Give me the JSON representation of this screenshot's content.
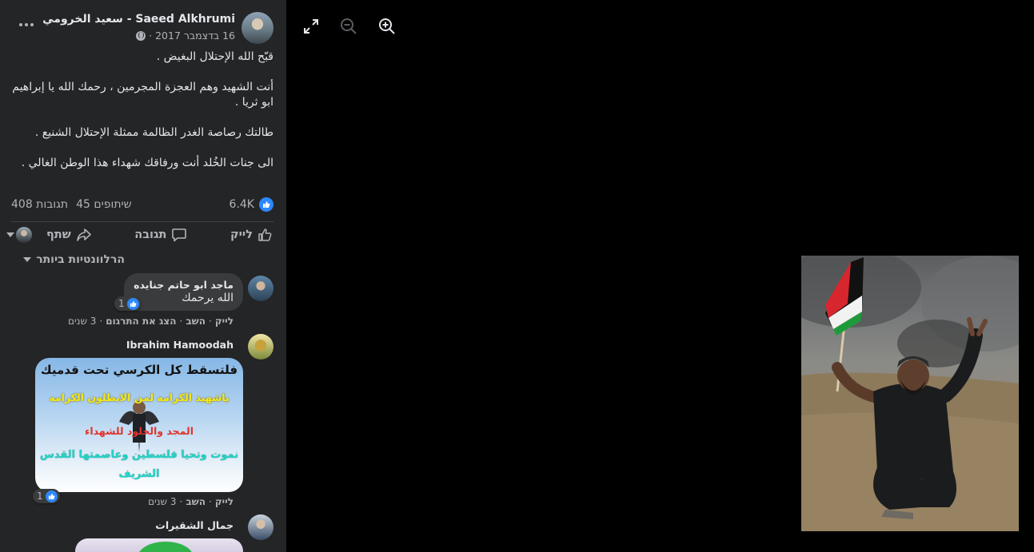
{
  "post": {
    "author": "Saeed Alkhrumi - سعيد الخرومي",
    "date": "16 בדצמבר 2017 ·",
    "text": [
      "قبّح الله الإحتلال البغيض .",
      "أنت الشهيد وهم العجزة المجرمين ، رحمك الله يا إبراهيم ابو ثريا .",
      "طالتك رصاصة الغدر الظالمة ممثلة الإحتلال الشنيع .",
      "الى جنات الخُلد أنت ورفاقك شهداء هذا الوطن الغالي ."
    ],
    "likes": "6.4K",
    "comments_count": "408 תגובות",
    "shares_count": "45 שיתופים",
    "more_icon": "more-horizontal-icon",
    "privacy_icon": "globe-icon"
  },
  "actions": {
    "like": "לייק",
    "comment": "תגובה",
    "share": "שתף"
  },
  "sort_label": "הרלוונטיות ביותר",
  "comments": [
    {
      "name": "ماجد ابو حاتم جنايده",
      "text": "الله يرحمك",
      "reactions": "1",
      "like": "לייק",
      "reply": "השב",
      "translate": "הצג את התרגום",
      "time": "3 שנים"
    },
    {
      "name": "Ibrahim Hamoodah",
      "sticker_lines": [
        "فلتسقط كل الكرسي تحت قدميك",
        "ياشهيد الكرامه لمن الابطلون الكرامه",
        "المجد والخلود للشهداء",
        "نموت وتحيا فلسطين وعاصمتها القدس",
        "الشريف"
      ],
      "reactions": "1",
      "like": "לייק",
      "reply": "השב",
      "time": "3 שנים"
    },
    {
      "name": "جمال الشقيرات"
    }
  ],
  "viewer": {
    "fullscreen_icon": "fullscreen-icon",
    "zoom_out_icon": "zoom-out-icon",
    "zoom_in_icon": "zoom-in-icon",
    "colors": {
      "background": "#000000",
      "accent": "#2d88ff",
      "panel": "#242526"
    }
  }
}
